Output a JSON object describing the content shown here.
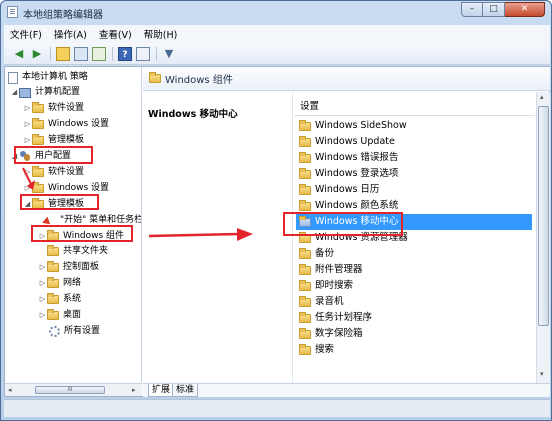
{
  "window": {
    "title": "本地组策略编辑器",
    "min": "–",
    "max": "□",
    "close": "✕"
  },
  "menu": [
    "文件(F)",
    "操作(A)",
    "查看(V)",
    "帮助(H)"
  ],
  "toolbar": {
    "icons": [
      "back-arrow-icon",
      "forward-arrow-icon",
      "up-folder-icon",
      "show-hide-tree-icon",
      "export-list-icon",
      "help-icon",
      "properties-icon",
      "filter-icon"
    ],
    "help_glyph": "?"
  },
  "tree": {
    "root": "本地计算机 策略",
    "computer_config": "计算机配置",
    "cc_software": "软件设置",
    "cc_windows": "Windows 设置",
    "cc_admin": "管理模板",
    "user_config": "用户配置",
    "uc_software": "软件设置",
    "uc_windows": "Windows 设置",
    "uc_admin": "管理模板",
    "start_menu": "\"开始\" 菜单和任务栏",
    "windows_components": "Windows 组件",
    "shared_folders": "共享文件夹",
    "control_panel": "控制面板",
    "network": "网络",
    "system": "系统",
    "desktop": "桌面",
    "all_settings": "所有设置"
  },
  "tree_scroll": {
    "left": "◂",
    "right": "▸",
    "thumb": "III"
  },
  "right_header": "Windows 组件",
  "description_title": "Windows 移动中心",
  "list": {
    "column": "设置",
    "items": [
      "Windows SideShow",
      "Windows Update",
      "Windows 错误报告",
      "Windows 登录选项",
      "Windows 日历",
      "Windows 颜色系统",
      "Windows 移动中心",
      "Windows 资源管理器",
      "备份",
      "附件管理器",
      "即时搜索",
      "录音机",
      "任务计划程序",
      "数字保险箱",
      "搜索"
    ],
    "selected": "Windows 移动中心"
  },
  "tabs": [
    "扩展",
    "标准"
  ],
  "colors": {
    "selection": "#3399ff",
    "annotation": "#e3242b"
  }
}
